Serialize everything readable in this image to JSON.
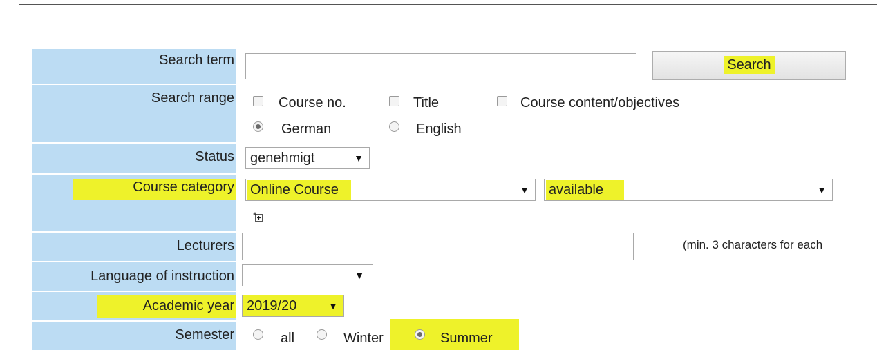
{
  "search_term": {
    "label": "Search term",
    "value": "",
    "button_label": "Search"
  },
  "search_range": {
    "label": "Search range",
    "options": [
      "Course no.",
      "Title",
      "Course content/objectives"
    ],
    "languages": [
      "German",
      "English"
    ]
  },
  "status": {
    "label": "Status",
    "selected": "genehmigt"
  },
  "course_category": {
    "label": "Course category",
    "selected": "Online Course",
    "sub_selected": "available"
  },
  "lecturers": {
    "label": "Lecturers",
    "value": "",
    "hint": "(min. 3 characters for each"
  },
  "language_of_instruction": {
    "label": "Language of instruction",
    "selected": ""
  },
  "academic_year": {
    "label": "Academic year",
    "selected": "2019/20"
  },
  "semester": {
    "label": "Semester",
    "options": [
      "all",
      "Winter",
      "Summer"
    ]
  },
  "colors": {
    "label_bg": "#bcdcf3",
    "highlight": "#eef22a"
  },
  "icons": {
    "caret": "▼",
    "expand": "expand-plus-icon"
  }
}
